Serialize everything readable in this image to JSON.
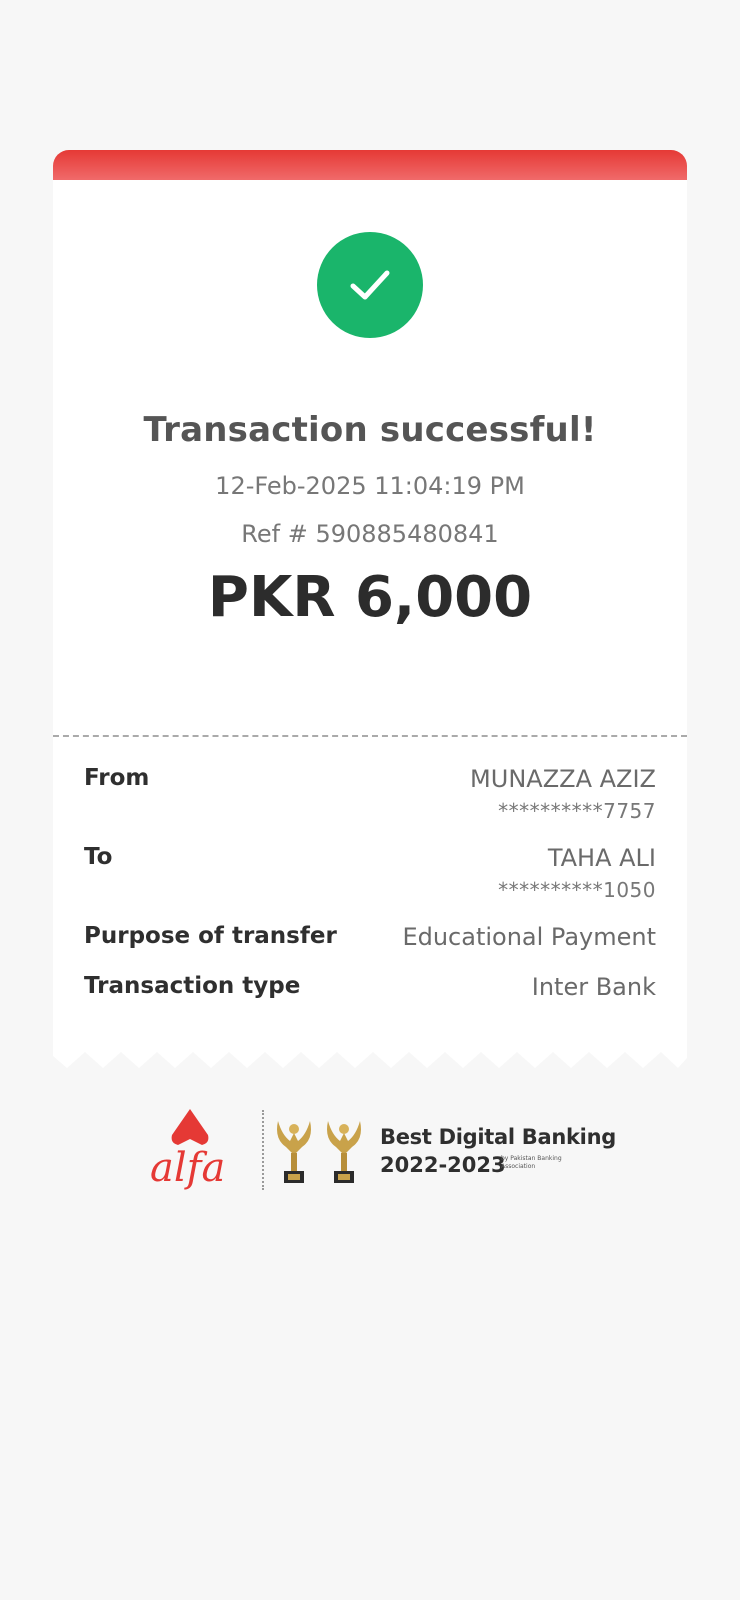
{
  "receipt": {
    "title": "Transaction successful!",
    "datetime": "12-Feb-2025 11:04:19 PM",
    "reference": "Ref # 590885480841",
    "amount": "PKR 6,000",
    "details": {
      "from": {
        "label": "From",
        "name": "MUNAZZA AZIZ",
        "account": "**********7757"
      },
      "to": {
        "label": "To",
        "name": "TAHA ALI",
        "account": "**********1050"
      },
      "purpose": {
        "label": "Purpose of transfer",
        "value": "Educational Payment"
      },
      "type": {
        "label": "Transaction type",
        "value": "Inter Bank"
      }
    }
  },
  "footer": {
    "brand": "alfa",
    "award_title": "Best Digital Banking",
    "award_years": "2022-2023",
    "award_by": "by Pakistan Banking Association"
  },
  "icons": {
    "success": "checkmark-icon",
    "trophy": "trophy-icon"
  },
  "colors": {
    "accent_red": "#e53935",
    "success_green": "#1ab56b",
    "gold": "#c9a24a"
  }
}
